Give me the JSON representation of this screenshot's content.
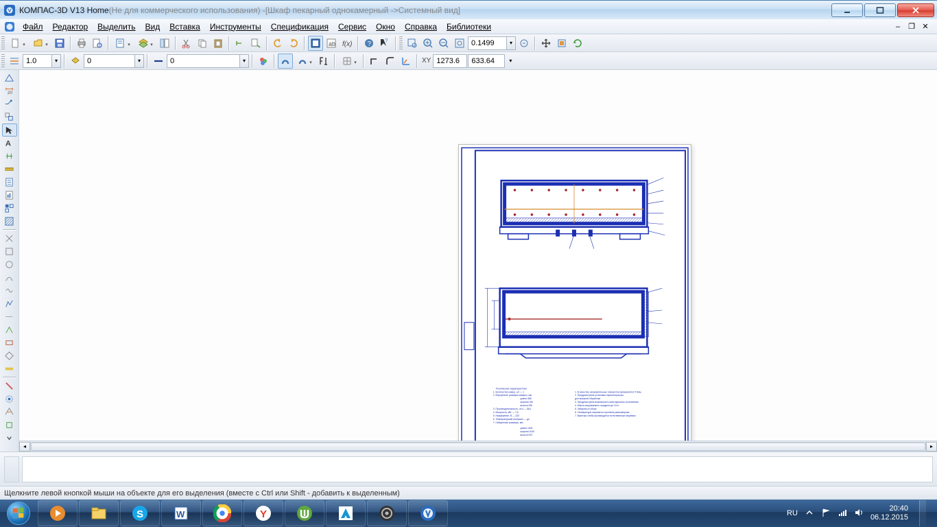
{
  "title": {
    "app": "КОМПАС-3D V13 Home",
    "note": " (Не для коммерческого использования) - ",
    "doc": "[Шкаф пекарный однокамерный ->Системный вид]"
  },
  "menu": [
    "Файл",
    "Редактор",
    "Выделить",
    "Вид",
    "Вставка",
    "Инструменты",
    "Спецификация",
    "Сервис",
    "Окно",
    "Справка",
    "Библиотеки"
  ],
  "toolbar2": {
    "zoom_value": "0.1499"
  },
  "toolbar3": {
    "line_width": "1.0",
    "style1": "0",
    "style2": "0",
    "coord_x": "1273.6",
    "coord_y": "633.64",
    "xy_label": "XY"
  },
  "status": "Щелкните левой кнопкой мыши на объекте для его выделения (вместе с Ctrl или Shift - добавить к выделенным)",
  "tray": {
    "lang": "RU",
    "time": "20:40",
    "date": "06.12.2015"
  }
}
